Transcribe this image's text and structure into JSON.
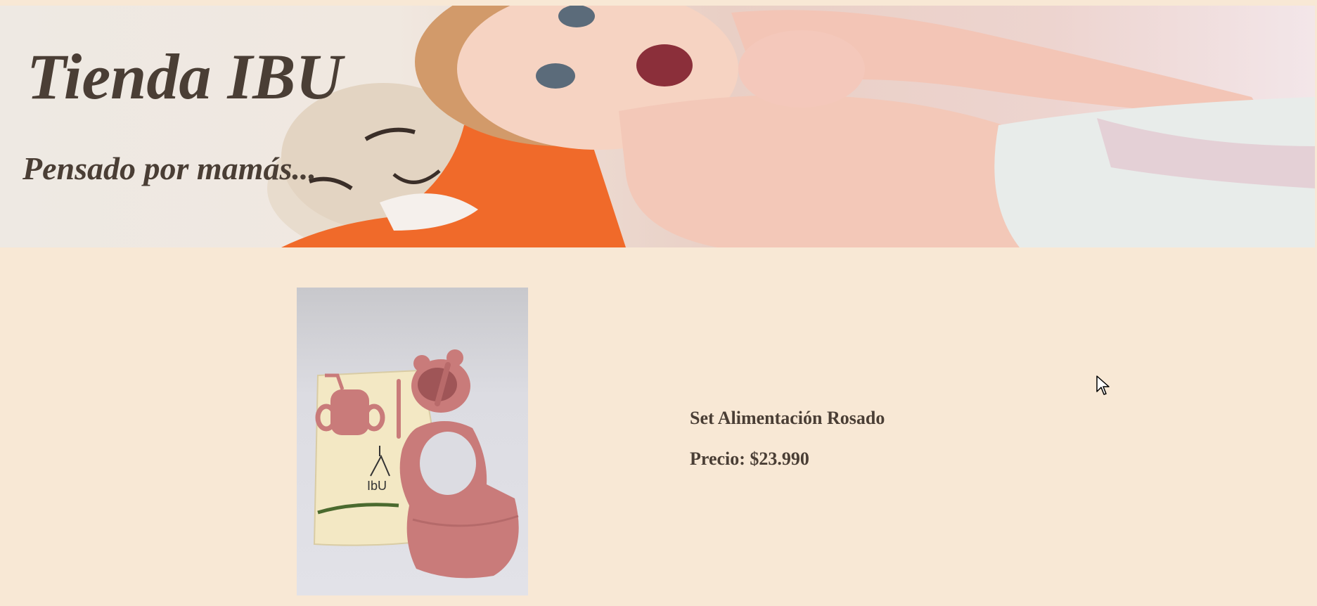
{
  "header": {
    "title": "Tienda IBU",
    "subtitle": "Pensado por mamás..."
  },
  "product": {
    "name": "Set Alimentación Rosado",
    "price_label": "Precio:",
    "price_value": "$23.990",
    "image_icon": "product-photo"
  },
  "colors": {
    "background": "#f8e8d5",
    "text": "#4a3e35",
    "product_pink": "#c97b7a"
  }
}
